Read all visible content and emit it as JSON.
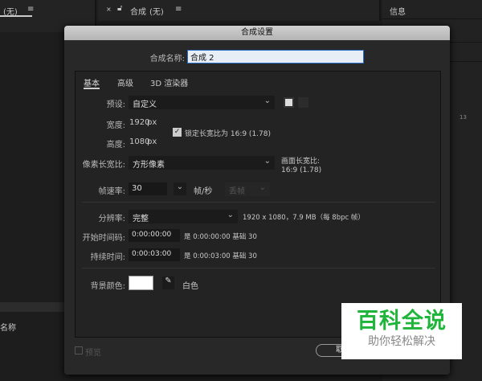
{
  "background": {
    "left_panel_none": "(无)",
    "comp_tab_label": "合成",
    "comp_tab_none": "(无)",
    "info_panel_title": "信息",
    "name_column": "名称",
    "side_number": "13"
  },
  "dialog": {
    "title": "合成设置",
    "name_label": "合成名称:",
    "name_value": "合成 2",
    "tabs": [
      {
        "label": "基本"
      },
      {
        "label": "高级"
      },
      {
        "label": "3D 渲染器"
      }
    ],
    "preset_label": "预设:",
    "preset_value": "自定义",
    "width_label": "宽度:",
    "width_value": "1920",
    "height_label": "高度:",
    "height_value": "1080",
    "px_unit": "px",
    "lock_aspect_label": "锁定长宽比为 16:9 (1.78)",
    "lock_aspect_checked": true,
    "pixel_aspect_label": "像素长宽比:",
    "pixel_aspect_value": "方形像素",
    "frame_aspect_label": "画面长宽比:",
    "frame_aspect_value": "16:9 (1.78)",
    "fps_label": "帧速率:",
    "fps_value": "30",
    "fps_unit": "帧/秒",
    "drop_frame_value": "丢帧",
    "resolution_label": "分辨率:",
    "resolution_value": "完整",
    "resolution_info": "1920 x 1080，7.9 MB（每 8bpc 帧）",
    "start_tc_label": "开始时间码:",
    "start_tc_value": "0:00:00:00",
    "start_tc_info": "是 0:00:00:00 基础 30",
    "duration_label": "持续时间:",
    "duration_value": "0:00:03:00",
    "duration_info": "是 0:00:03:00 基础 30",
    "bg_color_label": "背景颜色:",
    "bg_color": "#ffffff",
    "bg_color_name": "白色",
    "preview_label": "预览",
    "cancel_label": "取消"
  },
  "watermark": {
    "title": "百科全说",
    "subtitle": "助你轻松解决",
    "color": "#1fb53a"
  }
}
